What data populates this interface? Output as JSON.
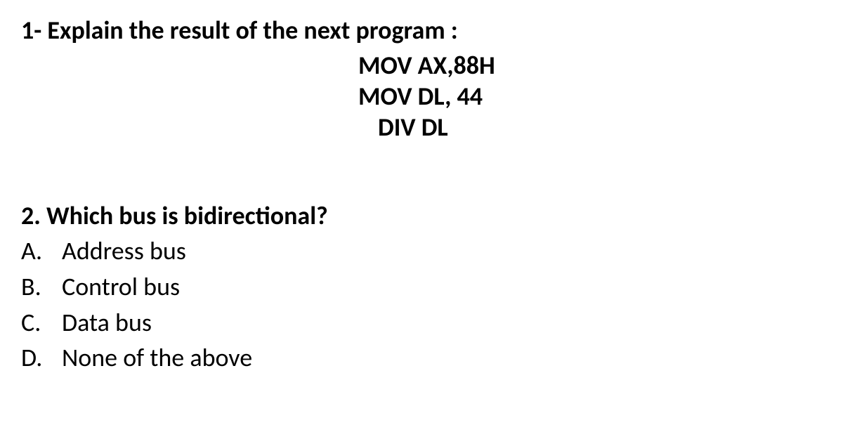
{
  "question1": {
    "prompt": "1- Explain the result of the next program :",
    "code": {
      "line1": "MOV AX,88H",
      "line2": "MOV DL, 44",
      "line3": "DIV DL"
    }
  },
  "question2": {
    "prompt": "2. Which bus is bidirectional?",
    "options": [
      {
        "letter": "A.",
        "text": "Address bus"
      },
      {
        "letter": "B.",
        "text": "Control bus"
      },
      {
        "letter": "C.",
        "text": "Data bus"
      },
      {
        "letter": "D.",
        "text": "None of the above"
      }
    ]
  }
}
